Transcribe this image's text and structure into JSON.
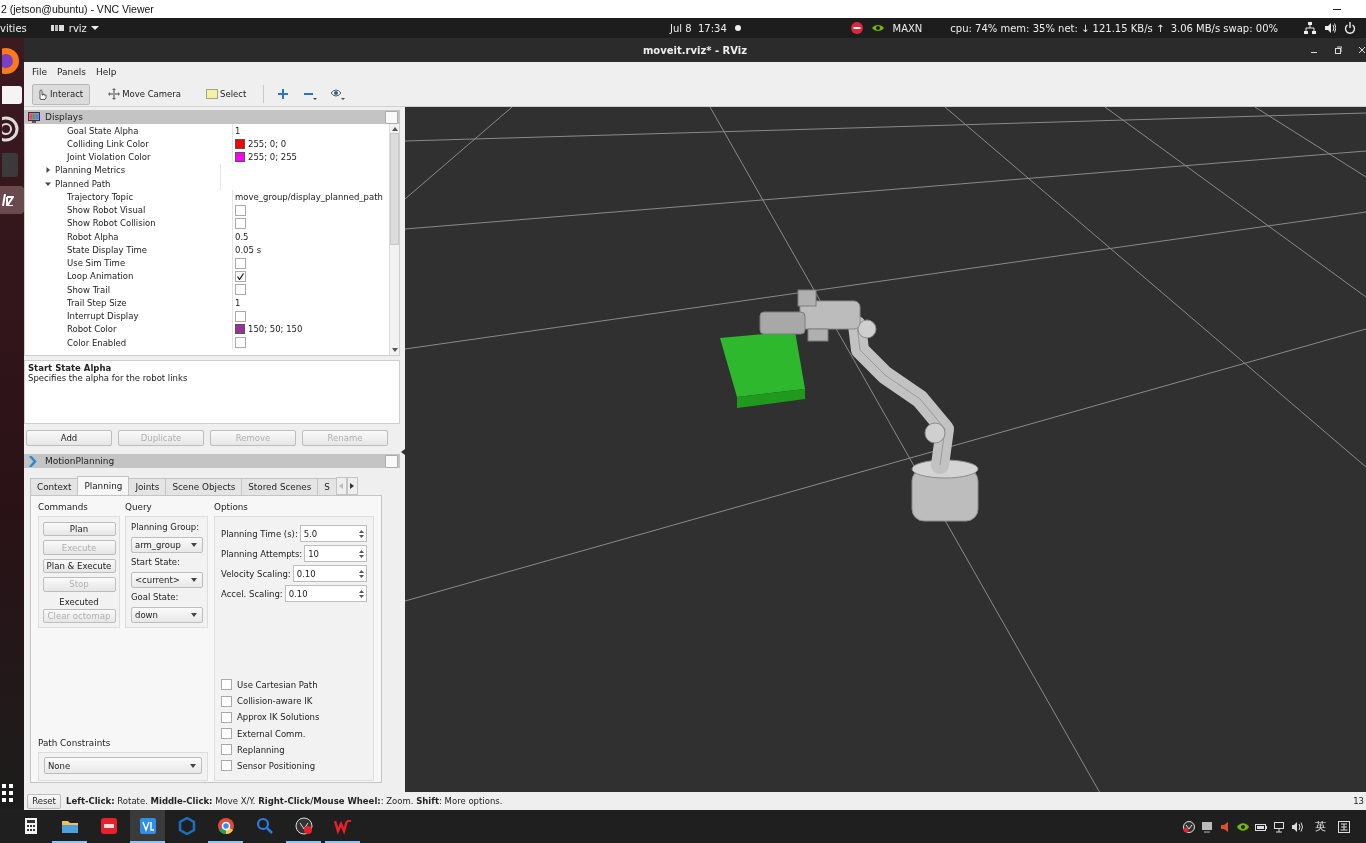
{
  "vnc_window": {
    "title": "2 (jetson@ubuntu) - VNC Viewer"
  },
  "top_bar": {
    "activities": "vities",
    "app_menu": "rviz",
    "clock": "Jul 8  17:34",
    "power_mode": "MAXN",
    "system_monitor": "cpu: 74% mem: 35% net: ↓ 121.15 KB/s ↑  3.06 MB/s swap: 00%"
  },
  "dock": [
    {
      "kind": "browser",
      "selected": false
    },
    {
      "kind": "files",
      "selected": false
    },
    {
      "kind": "settings",
      "selected": false
    },
    {
      "kind": "terminal",
      "selected": false
    },
    {
      "kind": "rviz",
      "selected": true
    },
    {
      "kind": "apps",
      "selected": false
    }
  ],
  "rviz": {
    "title": "moveit.rviz* - RViz",
    "menu": [
      "File",
      "Panels",
      "Help"
    ],
    "tools": [
      {
        "kind": "interact",
        "label": "Interact",
        "selected": true
      },
      {
        "kind": "move_camera",
        "label": "Move Camera",
        "selected": false
      },
      {
        "kind": "select",
        "label": "Select",
        "selected": false
      },
      {
        "kind": "add",
        "selected": false
      },
      {
        "kind": "remove",
        "selected": false
      },
      {
        "kind": "view",
        "selected": false
      }
    ]
  },
  "displays": {
    "title": "Displays",
    "continued_rows": [
      {
        "name": "Goal State Alpha",
        "kind": "text",
        "value": "1"
      },
      {
        "name": "Colliding Link Color",
        "kind": "color",
        "value": "255; 0; 0",
        "color": "#ff0000"
      },
      {
        "name": "Joint Violation Color",
        "kind": "color",
        "value": "255; 0; 255",
        "color": "#ff00ff"
      }
    ],
    "rows": [
      {
        "name": "Planning Metrics",
        "kind": "group",
        "expanded": false
      },
      {
        "name": "Planned Path",
        "kind": "group",
        "expanded": true,
        "children": [
          {
            "name": "Trajectory Topic",
            "kind": "text",
            "value": "move_group/display_planned_path"
          },
          {
            "name": "Show Robot Visual",
            "kind": "checkbox",
            "checked": false
          },
          {
            "name": "Show Robot Collision",
            "kind": "checkbox",
            "checked": false
          },
          {
            "name": "Robot Alpha",
            "kind": "text",
            "value": "0.5"
          },
          {
            "name": "State Display Time",
            "kind": "text",
            "value": "0.05 s"
          },
          {
            "name": "Use Sim Time",
            "kind": "checkbox",
            "checked": false
          },
          {
            "name": "Loop Animation",
            "kind": "checkbox",
            "checked": true
          },
          {
            "name": "Show Trail",
            "kind": "checkbox",
            "checked": false
          },
          {
            "name": "Trail Step Size",
            "kind": "text",
            "value": "1"
          },
          {
            "name": "Interrupt Display",
            "kind": "checkbox",
            "checked": false
          },
          {
            "name": "Robot Color",
            "kind": "color",
            "value": "150; 50; 150",
            "color": "#963296"
          },
          {
            "name": "Color Enabled",
            "kind": "checkbox",
            "checked": false
          }
        ]
      }
    ],
    "description": {
      "title": "Start State Alpha",
      "text": "Specifies the alpha for the robot links"
    },
    "buttons": [
      {
        "label": "Add",
        "disabled": false
      },
      {
        "label": "Duplicate",
        "disabled": true
      },
      {
        "label": "Remove",
        "disabled": true
      },
      {
        "label": "Rename",
        "disabled": true
      }
    ]
  },
  "motion_planning": {
    "title": "MotionPlanning",
    "tabs": [
      {
        "label": "Context",
        "selected": false
      },
      {
        "label": "Planning",
        "selected": true
      },
      {
        "label": "Joints",
        "selected": false
      },
      {
        "label": "Scene Objects",
        "selected": false
      },
      {
        "label": "Stored Scenes",
        "selected": false
      },
      {
        "label": "S",
        "selected": false
      }
    ],
    "commands": {
      "title": "Commands",
      "items": [
        {
          "kind": "button",
          "label": "Plan",
          "disabled": false
        },
        {
          "kind": "button",
          "label": "Execute",
          "disabled": true
        },
        {
          "kind": "button",
          "label": "Plan & Execute",
          "disabled": false
        },
        {
          "kind": "button",
          "label": "Stop",
          "disabled": true
        },
        {
          "kind": "status",
          "label": "Executed"
        },
        {
          "kind": "button",
          "label": "Clear octomap",
          "disabled": true
        }
      ]
    },
    "query": {
      "title": "Query",
      "fields": [
        {
          "label": "Planning Group:",
          "value": "arm_group"
        },
        {
          "label": "Start State:",
          "value": "<current>"
        },
        {
          "label": "Goal State:",
          "value": "down"
        }
      ]
    },
    "options": {
      "title": "Options",
      "spinboxes": [
        {
          "label": "Planning Time (s):",
          "value": "5.0"
        },
        {
          "label": "Planning Attempts:",
          "value": "10"
        },
        {
          "label": "Velocity Scaling:",
          "value": "0.10"
        },
        {
          "label": "Accel. Scaling:",
          "value": "0.10"
        }
      ],
      "checkboxes": [
        {
          "label": "Use Cartesian Path",
          "checked": false
        },
        {
          "label": "Collision-aware IK",
          "checked": false
        },
        {
          "label": "Approx IK Solutions",
          "checked": false
        },
        {
          "label": "External Comm.",
          "checked": false
        },
        {
          "label": "Replanning",
          "checked": false
        },
        {
          "label": "Sensor Positioning",
          "checked": false
        }
      ]
    },
    "path_constraints": {
      "title": "Path Constraints",
      "value": "None"
    }
  },
  "status_bar": {
    "reset": "Reset",
    "hint": "**Left-Click:** Rotate. **Middle-Click:** Move X/Y. **Right-Click/Mouse Wheel:**: Zoom. **Shift**: More options.",
    "coordinate": "13"
  },
  "taskbar": {
    "apps": [
      {
        "kind": "calculator",
        "running": false,
        "selected": false
      },
      {
        "kind": "folder",
        "running": true,
        "selected": false
      },
      {
        "kind": "red_app",
        "running": false,
        "selected": false
      },
      {
        "kind": "code_editor",
        "running": true,
        "selected": true
      },
      {
        "kind": "ring",
        "running": false,
        "selected": false
      },
      {
        "kind": "chrome",
        "running": true,
        "selected": false
      },
      {
        "kind": "search",
        "running": false,
        "selected": false
      },
      {
        "kind": "recorder",
        "running": true,
        "selected": false
      },
      {
        "kind": "wps",
        "running": true,
        "selected": false
      }
    ],
    "tray": [
      {
        "kind": "recorder"
      },
      {
        "kind": "monitor"
      },
      {
        "kind": "speaker_alert"
      },
      {
        "kind": "nvidia"
      },
      {
        "kind": "battery"
      },
      {
        "kind": "network"
      },
      {
        "kind": "volume"
      }
    ],
    "input_method": "英"
  }
}
